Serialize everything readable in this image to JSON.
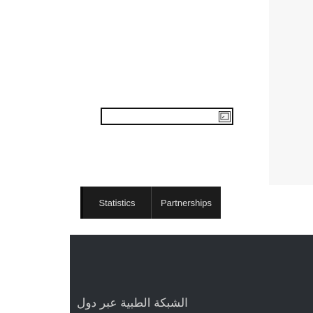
{
  "search": {
    "placeholder": "",
    "button_icon": "search-icon"
  },
  "tabs": [
    {
      "label": "Statistics"
    },
    {
      "label": "Partnerships"
    }
  ],
  "info_panel": {
    "title": "الشبكة الطبية عبر دول"
  },
  "colors": {
    "tab_background": "#1c1c1c",
    "panel_background": "#2a2e33",
    "side_panel_background": "#f7f7f7"
  }
}
